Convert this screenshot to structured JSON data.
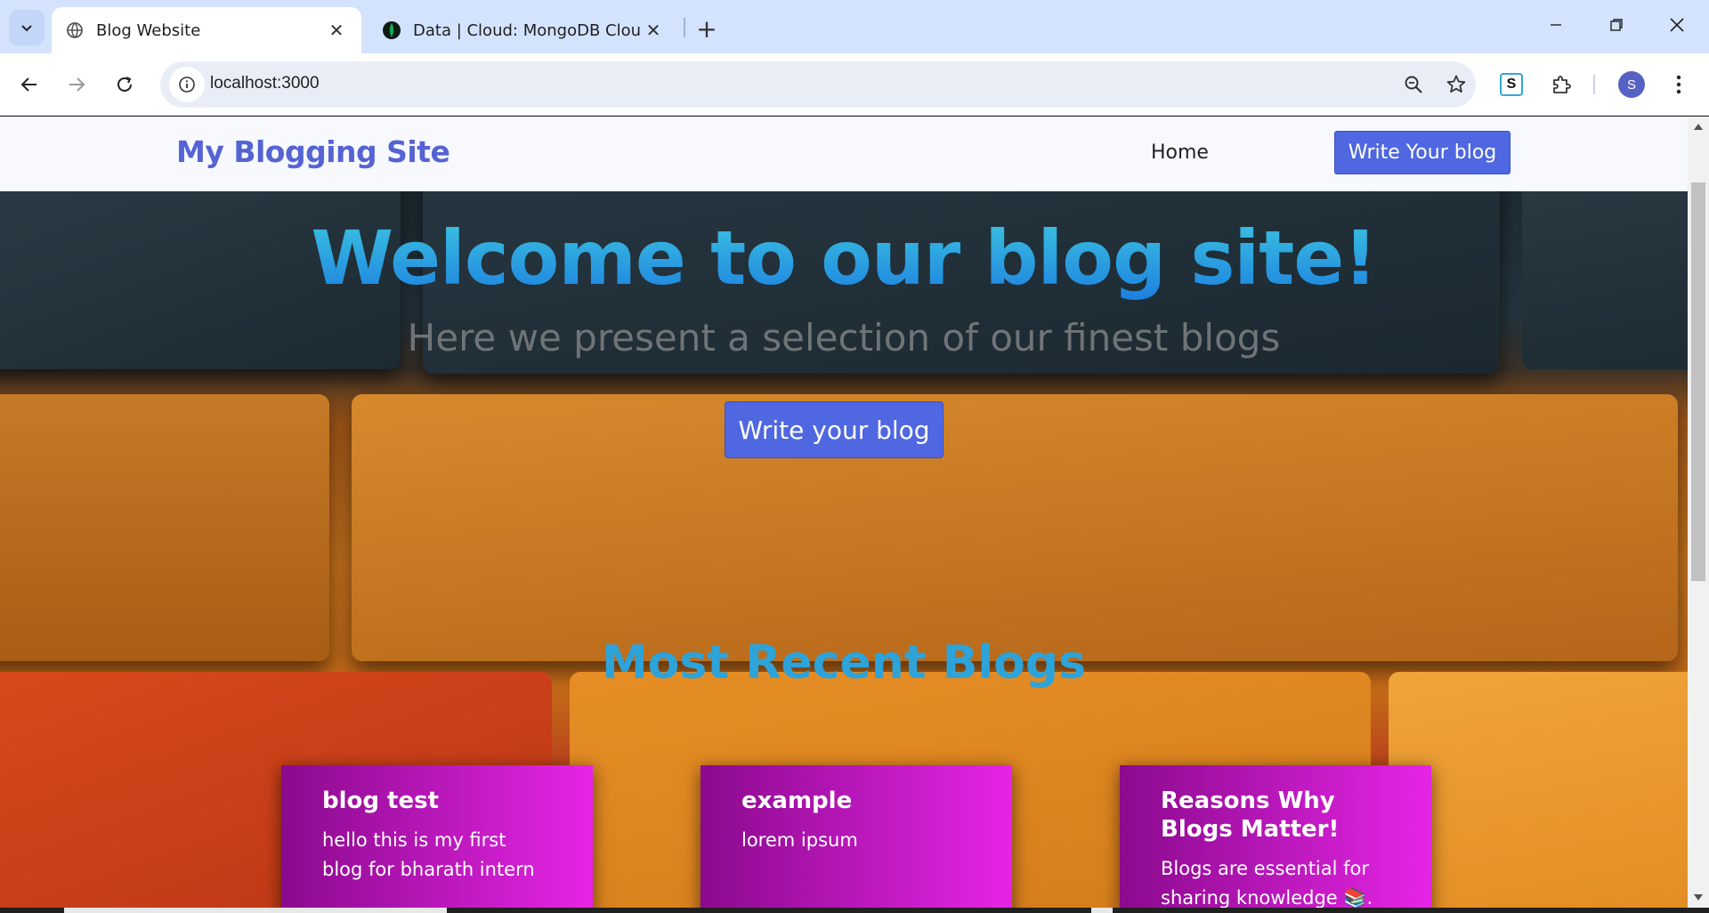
{
  "browser": {
    "tabs": [
      {
        "title": "Blog Website",
        "favicon": "globe-icon",
        "active": true
      },
      {
        "title": "Data | Cloud: MongoDB Cloud",
        "favicon": "mongodb-leaf-icon",
        "active": false
      }
    ],
    "url": "localhost:3000",
    "profile_initial": "S",
    "extension_letter": "S"
  },
  "site": {
    "brand": "My Blogging Site",
    "nav": {
      "home": "Home",
      "write": "Write Your blog"
    },
    "hero": {
      "title": "Welcome to our blog site!",
      "subtitle": "Here we present a selection of our finest blogs",
      "button": "Write your blog"
    },
    "recent": {
      "heading": "Most Recent Blogs",
      "cards": [
        {
          "title": "blog test",
          "body": "hello this is my first blog for bharath intern"
        },
        {
          "title": "example",
          "body": "lorem ipsum"
        },
        {
          "title": "Reasons Why Blogs Matter!",
          "body": "Blogs are essential for sharing knowledge 📚."
        }
      ]
    }
  },
  "colors": {
    "brand": "#5563d3",
    "button": "#4f67e0",
    "card_start": "#8b0a8d",
    "card_end": "#e625e6",
    "heading": "#2da3d9"
  }
}
